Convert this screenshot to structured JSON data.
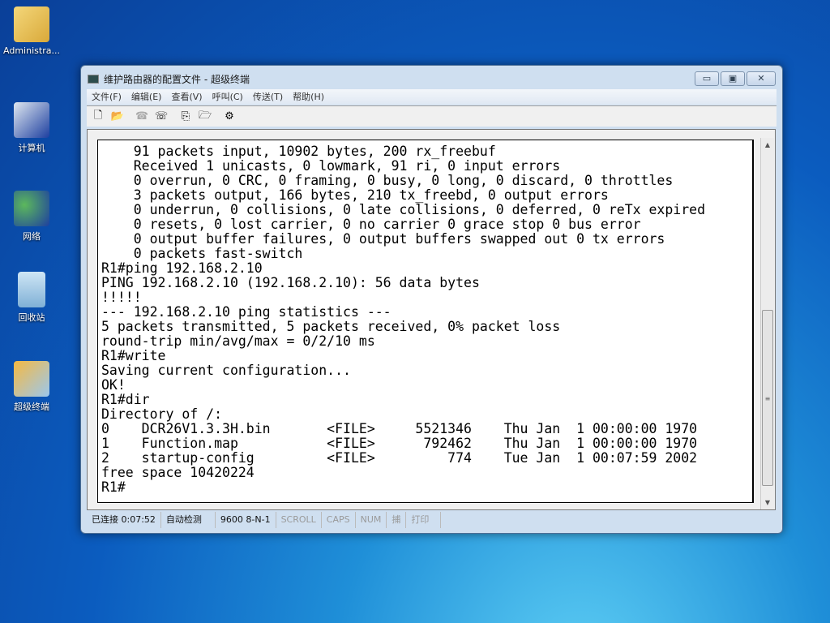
{
  "desktop": {
    "icons": [
      "Administra...",
      "计算机",
      "网络",
      "回收站",
      "超级终端"
    ]
  },
  "window": {
    "title": "维护路由器的配置文件 - 超级终端",
    "controls": {
      "minimize": "▭",
      "maximize": "▣",
      "close": "✕"
    }
  },
  "menu": [
    "文件(F)",
    "编辑(E)",
    "查看(V)",
    "呼叫(C)",
    "传送(T)",
    "帮助(H)"
  ],
  "toolbar": [
    {
      "name": "new-icon",
      "glyph": "🗋"
    },
    {
      "name": "open-icon",
      "glyph": "📂"
    },
    {
      "name": "call-icon",
      "glyph": "☎"
    },
    {
      "name": "disconnect-icon",
      "glyph": "☏"
    },
    {
      "name": "send-icon",
      "glyph": "⎘"
    },
    {
      "name": "receive-icon",
      "glyph": "🗁"
    },
    {
      "name": "properties-icon",
      "glyph": "⚙"
    }
  ],
  "terminal": {
    "lines": [
      "    91 packets input, 10902 bytes, 200 rx_freebuf",
      "    Received 1 unicasts, 0 lowmark, 91 ri, 0 input errors",
      "    0 overrun, 0 CRC, 0 framing, 0 busy, 0 long, 0 discard, 0 throttles",
      "    3 packets output, 166 bytes, 210 tx_freebd, 0 output errors",
      "    0 underrun, 0 collisions, 0 late collisions, 0 deferred, 0 reTx expired",
      "    0 resets, 0 lost carrier, 0 no carrier 0 grace stop 0 bus error",
      "    0 output buffer failures, 0 output buffers swapped out 0 tx errors",
      "    0 packets fast-switch",
      "R1#ping 192.168.2.10",
      "PING 192.168.2.10 (192.168.2.10): 56 data bytes",
      "!!!!!",
      "--- 192.168.2.10 ping statistics ---",
      "5 packets transmitted, 5 packets received, 0% packet loss",
      "round-trip min/avg/max = 0/2/10 ms",
      "R1#write",
      "Saving current configuration...",
      "OK!",
      "R1#dir",
      "Directory of /:",
      "0    DCR26V1.3.3H.bin       <FILE>     5521346    Thu Jan  1 00:00:00 1970",
      "1    Function.map           <FILE>      792462    Thu Jan  1 00:00:00 1970",
      "2    startup-config         <FILE>         774    Tue Jan  1 00:07:59 2002",
      "free space 10420224",
      "R1#"
    ]
  },
  "status": {
    "connected": "已连接 0:07:52",
    "detect": "自动检测",
    "baud": "9600 8-N-1",
    "scroll": "SCROLL",
    "caps": "CAPS",
    "num": "NUM",
    "capture": "捕",
    "print": "打印"
  }
}
